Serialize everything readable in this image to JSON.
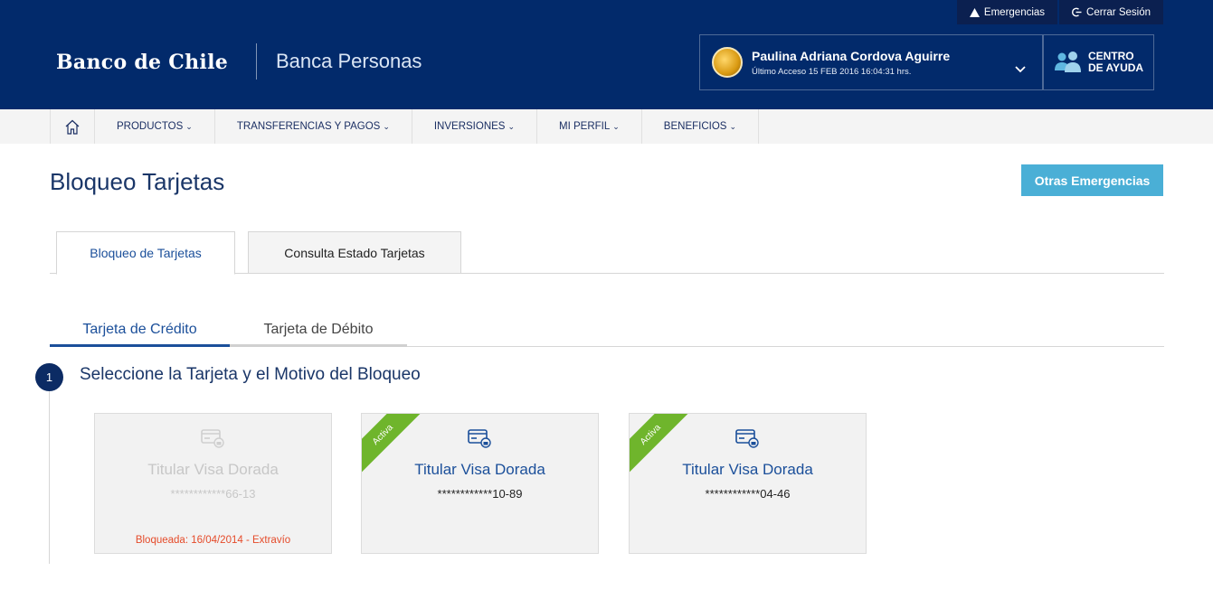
{
  "header": {
    "top_links": [
      {
        "label": "Emergencias",
        "icon": "warning-icon"
      },
      {
        "label": "Cerrar Sesión",
        "icon": "logout-icon"
      }
    ],
    "logo": "Banco de Chile",
    "subbrand": "Banca Personas",
    "user": {
      "name": "Paulina Adriana Cordova Aguirre",
      "last_access": "Último Acceso 15 FEB 2016 16:04:31 hrs."
    },
    "help": {
      "line1": "CENTRO",
      "line2": "DE AYUDA"
    }
  },
  "nav": {
    "items": [
      {
        "label": "PRODUCTOS"
      },
      {
        "label": "TRANSFERENCIAS Y PAGOS"
      },
      {
        "label": "INVERSIONES"
      },
      {
        "label": "MI PERFIL"
      },
      {
        "label": "BENEFICIOS"
      }
    ]
  },
  "page": {
    "title": "Bloqueo Tarjetas",
    "other_emergencies_label": "Otras Emergencias",
    "tabs": [
      {
        "label": "Bloqueo de Tarjetas"
      },
      {
        "label": "Consulta Estado Tarjetas"
      }
    ],
    "subtabs": [
      {
        "label": "Tarjeta de Crédito"
      },
      {
        "label": "Tarjeta de Débito"
      }
    ],
    "step": {
      "number": "1",
      "label": "Seleccione la Tarjeta y el Motivo del Bloqueo"
    },
    "cards": [
      {
        "title": "Titular Visa Dorada",
        "number": "************66-13",
        "status": "Bloqueada: 16/04/2014 - Extravío"
      },
      {
        "title": "Titular Visa Dorada",
        "number": "************10-89",
        "ribbon": "Activa"
      },
      {
        "title": "Titular Visa Dorada",
        "number": "************04-46",
        "ribbon": "Activa"
      }
    ]
  },
  "colors": {
    "header_bg": "#022a6b",
    "accent_blue": "#1b4f9a",
    "button_blue": "#4aafd6",
    "active_green": "#6fb52c",
    "blocked_red": "#e54b2a"
  }
}
